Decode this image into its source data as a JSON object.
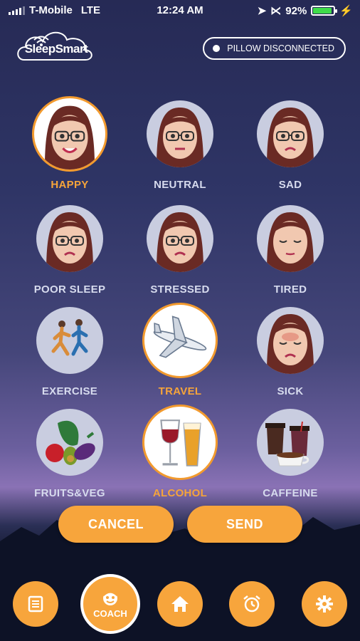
{
  "status_bar": {
    "carrier": "T-Mobile",
    "network": "LTE",
    "time": "12:24 AM",
    "battery": "92%",
    "battery_level": 0.92
  },
  "header": {
    "logo_text": "SleepSmart",
    "pillow_status": "PILLOW DISCONNECTED"
  },
  "moods": [
    {
      "label": "HAPPY",
      "selected": true,
      "icon": "happy-face-icon"
    },
    {
      "label": "NEUTRAL",
      "selected": false,
      "icon": "neutral-face-icon"
    },
    {
      "label": "SAD",
      "selected": false,
      "icon": "sad-face-icon"
    },
    {
      "label": "POOR SLEEP",
      "selected": false,
      "icon": "poor-sleep-face-icon"
    },
    {
      "label": "STRESSED",
      "selected": false,
      "icon": "stressed-face-icon"
    },
    {
      "label": "TIRED",
      "selected": false,
      "icon": "tired-face-icon"
    },
    {
      "label": "EXERCISE",
      "selected": false,
      "icon": "runners-icon"
    },
    {
      "label": "TRAVEL",
      "selected": true,
      "icon": "airplane-icon"
    },
    {
      "label": "SICK",
      "selected": false,
      "icon": "sick-face-icon"
    },
    {
      "label": "FRUITS&VEG",
      "selected": false,
      "icon": "fruits-veg-icon"
    },
    {
      "label": "ALCOHOL",
      "selected": true,
      "icon": "wine-beer-icon"
    },
    {
      "label": "CAFFEINE",
      "selected": false,
      "icon": "coffee-cups-icon"
    }
  ],
  "actions": {
    "cancel": "CANCEL",
    "send": "SEND"
  },
  "nav": {
    "coach_label": "COACH",
    "items": [
      "journal-icon",
      "coach-icon",
      "home-icon",
      "alarm-icon",
      "settings-icon"
    ]
  },
  "colors": {
    "accent": "#f7a53c",
    "selected_label": "#f6a43a",
    "label": "#d7dbee"
  }
}
